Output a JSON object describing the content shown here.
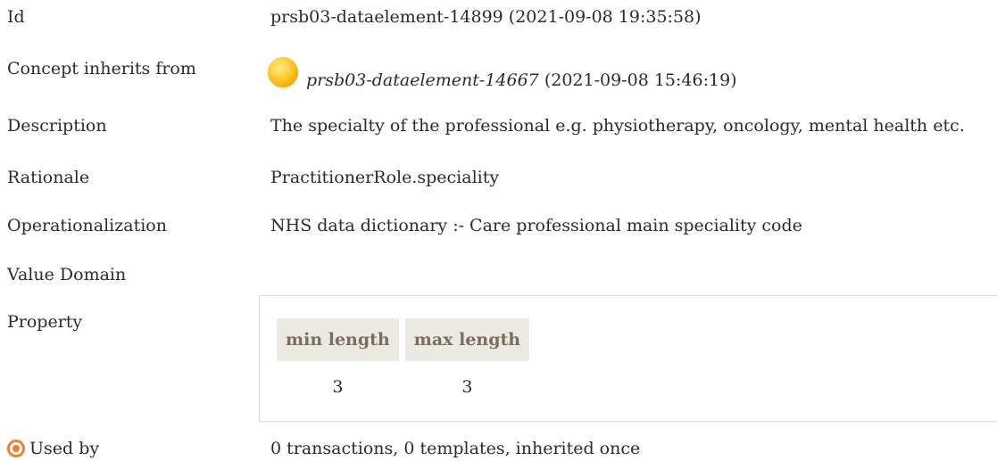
{
  "rows": {
    "id": {
      "label": "Id",
      "value": "prsb03-dataelement-14899 (2021-09-08 19:35:58)"
    },
    "inherits": {
      "label": "Concept inherits from",
      "link": "prsb03-dataelement-14667",
      "timestamp": "(2021-09-08 15:46:19)"
    },
    "description": {
      "label": "Description",
      "value": "The specialty of the professional e.g. physiotherapy, oncology, mental health etc."
    },
    "rationale": {
      "label": "Rationale",
      "value": "PractitionerRole.speciality"
    },
    "operationalization": {
      "label": "Operationalization",
      "value": "NHS data dictionary :- Care professional main speciality code"
    },
    "value_domain": {
      "label": "Value Domain"
    },
    "property": {
      "label": "Property",
      "headers": [
        "min length",
        "max length"
      ],
      "values": [
        "3",
        "3"
      ]
    },
    "used_by": {
      "label": "Used by",
      "value": "0 transactions, 0 templates, inherited once"
    }
  },
  "colors": {
    "inherit_bullet": "#f3a800",
    "used_by_icon": "#f07f2e",
    "table_header_bg": "#ece9e2",
    "table_header_text": "#7a6f5f"
  },
  "icons": {
    "inherit_bullet": "yellow-circle-icon",
    "used_by": "target-icon"
  }
}
